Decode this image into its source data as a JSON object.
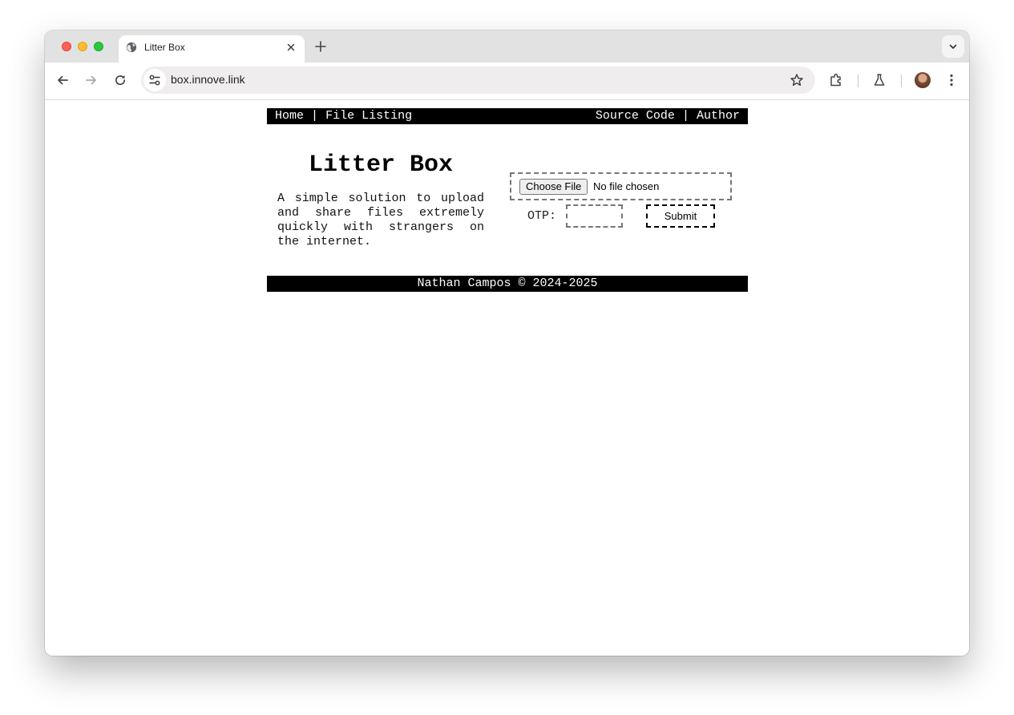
{
  "browser": {
    "tab_title": "Litter Box",
    "url": "box.innove.link"
  },
  "nav": {
    "home": "Home",
    "separator": "|",
    "file_listing": "File Listing",
    "source_code": "Source Code",
    "author": "Author"
  },
  "main": {
    "title": "Litter Box",
    "tagline": "A simple solution to upload and share files extremely quickly with strangers on the internet.",
    "choose_file_label": "Choose File",
    "file_status": "No file chosen",
    "otp_label": "OTP:",
    "otp_value": "",
    "submit_label": "Submit"
  },
  "footer": {
    "text": "Nathan Campos © 2024-2025"
  }
}
